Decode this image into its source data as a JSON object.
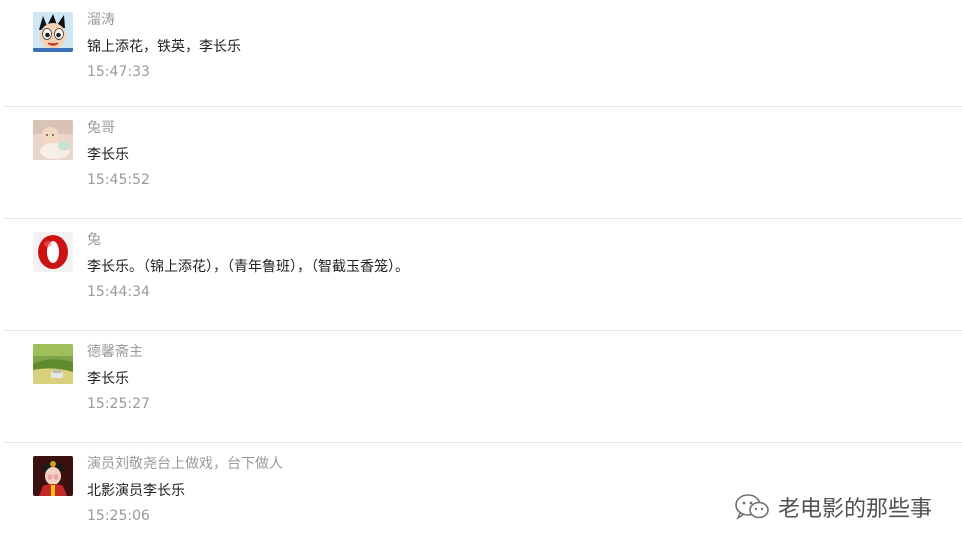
{
  "comments": [
    {
      "nickname": "溜涛",
      "content": "锦上添花，铁英，李长乐",
      "time": "15:47:33",
      "avatar": "astro-boy-avatar"
    },
    {
      "nickname": "兔哥",
      "content": "李长乐",
      "time": "15:45:52",
      "avatar": "baby-photo-avatar"
    },
    {
      "nickname": "兔",
      "content": "李长乐。（锦上添花），（青年鲁班），（智截玉香笼）。",
      "time": "15:44:34",
      "avatar": "opera-logo-avatar"
    },
    {
      "nickname": "德馨斋主",
      "content": "李长乐",
      "time": "15:25:27",
      "avatar": "landscape-avatar"
    },
    {
      "nickname": "演员刘敬尧台上做戏，台下做人",
      "content": "北影演员李长乐",
      "time": "15:25:06",
      "avatar": "opera-performer-avatar"
    }
  ],
  "watermark": {
    "text": "老电影的那些事",
    "icon": "wechat-icon"
  },
  "colors": {
    "nickname": "#9a9a9a",
    "content": "#222222",
    "time": "#9a9a9a",
    "divider": "#e5e5e5"
  }
}
